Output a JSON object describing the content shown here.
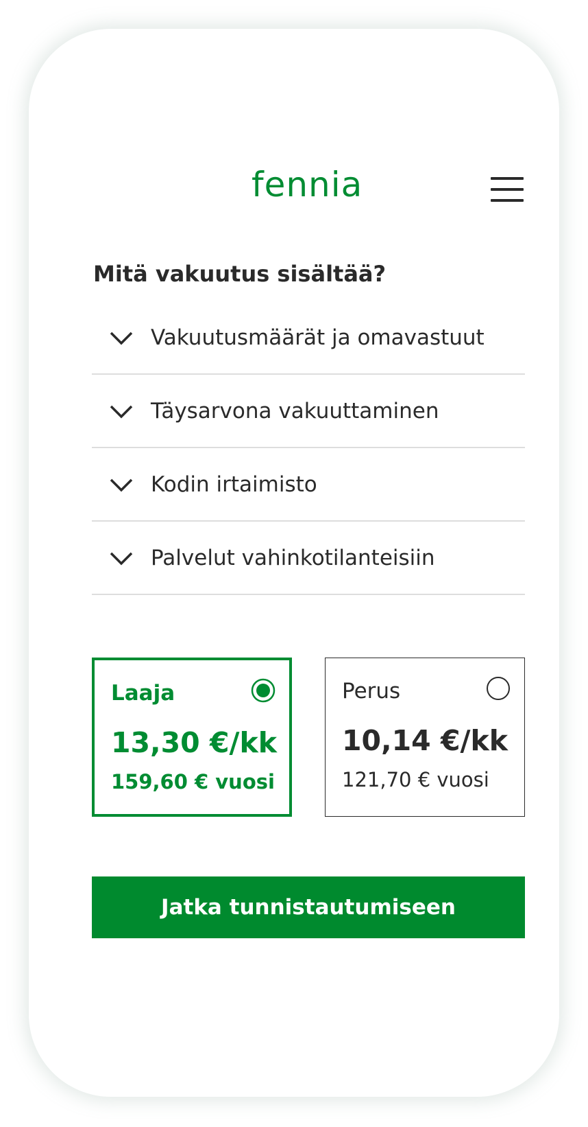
{
  "header": {
    "logo_text": "fennia",
    "menu_icon": "hamburger-menu-icon",
    "brand_color": "#008c32"
  },
  "section": {
    "title": "Mitä vakuutus sisältää?"
  },
  "accordion": {
    "items": [
      {
        "label": "Vakuutusmäärät ja omavastuut",
        "icon": "chevron-down-icon",
        "expanded": false
      },
      {
        "label": "Täysarvona vakuuttaminen",
        "icon": "chevron-down-icon",
        "expanded": false
      },
      {
        "label": "Kodin irtaimisto",
        "icon": "chevron-down-icon",
        "expanded": false
      },
      {
        "label": "Palvelut vahinkotilanteisiin",
        "icon": "chevron-down-icon",
        "expanded": false
      }
    ]
  },
  "plans": [
    {
      "name": "Laaja",
      "monthly": "13,30 €/kk",
      "yearly": "159,60 € vuosi",
      "selected": true
    },
    {
      "name": "Perus",
      "monthly": "10,14 €/kk",
      "yearly": "121,70 € vuosi",
      "selected": false
    }
  ],
  "cta": {
    "label": "Jatka tunnistautumiseen",
    "color": "#008a2e"
  },
  "colors": {
    "text": "#2a2a2a",
    "divider": "#dddddd",
    "background": "#ffffff"
  }
}
